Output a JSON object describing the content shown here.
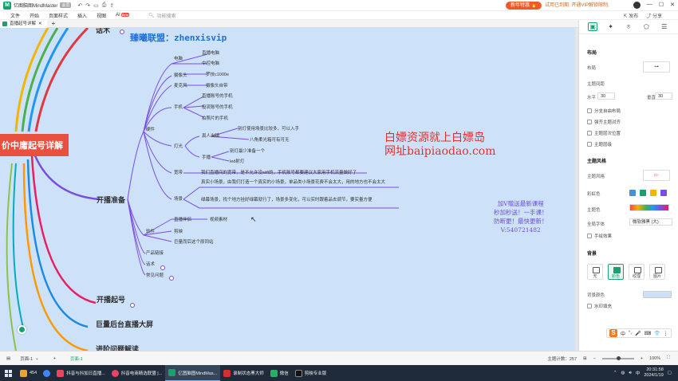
{
  "app": {
    "title": "亿图脑图MindMaster",
    "edition_badge": "会员",
    "promo_pill": "新年特惠 🔥",
    "vip_text": "试用已到期, 开通VIP解锁限制,",
    "publish": "发布",
    "share": "分享",
    "avatar_initials": "张"
  },
  "menu": {
    "items": [
      "文件",
      "开始",
      "页面样式",
      "插入",
      "视图",
      "AI"
    ],
    "ai_badge": "Beta",
    "search_placeholder": "功能搜索"
  },
  "tab": {
    "doc_name": "直播起号详解"
  },
  "canvas": {
    "central": "价中庸起号详解",
    "topics": {
      "top_cut": "话术",
      "prep": "开播准备",
      "start": "开播起号",
      "screen": "巨量后台直播大屏",
      "advanced": "进阶问题解读"
    },
    "watermarks": {
      "w1": "臻曦联盟：zhenxisvip",
      "w2_line1": "白嫖资源就上白嫖岛",
      "w2_line2": "网址baipiaodao.com",
      "w3_line1": "加V赠送最新课程",
      "w3_line2": "秒加秒送！一手课！",
      "w3_line3": "防断更！最快更新！",
      "w3_line4": "V:540721482"
    },
    "nodes": {
      "hardware": "硬件",
      "computer": "电脑",
      "live_pc": "直播电脑",
      "mid_pc": "中控电脑",
      "camera": "摄像头",
      "logitech": "罗技c1000e",
      "mic": "麦克风",
      "cam_self": "摄像头自带",
      "phone": "手机",
      "phone_live": "直播账号的手机",
      "phone_ctrl": "投流账号的手机",
      "phone_photo": "拍照片的手机",
      "light": "灯光",
      "real_out": "真人出镜",
      "buy_light": "别灯使用场景比较多，可以入手",
      "octagon": "八角柔光箱可有可无",
      "handheld": "手播",
      "sole_light": "别灯最少准备一个",
      "led": "led射灯",
      "broadband": "宽带",
      "broadband_text": "我们直播间的宽带，是不允许没wifi的，手机账号都要建议大家用手机流量做好了",
      "scene": "场景",
      "scene_text1": "真实小场景，由我们打造一个真实的小场景，单品类小场景花费不会太大，用的地方也不会太大",
      "scene_text2": "绿幕场景，找个地方挂好绿幕就行了，场景多变化，可以实时跟着品去调节，要实量方便",
      "software": "软件",
      "live_partner": "直播伴侣",
      "video_material": "视频素材",
      "clip": "剪映",
      "other_soft": "巨量而后这个原同站",
      "product_link": "产品链接",
      "script": "话术",
      "common_q": "常见问题"
    }
  },
  "sidebar": {
    "layout_section": "布局",
    "layout_label": "布局",
    "spacing_label": "主题间距",
    "horizontal_label": "水平",
    "horizontal_value": "30",
    "vertical_label": "垂直",
    "vertical_value": "30",
    "checks": [
      "分支自由布局",
      "强齐主题对齐",
      "主题层次位置",
      "主题层级"
    ],
    "style_section": "主题风格",
    "theme_style_label": "主题风格",
    "color_label": "彩虹色",
    "theme_color_label": "主题色",
    "font_label": "全局字体",
    "font_value": "微软雅黑 (大)",
    "hand_drawn": "手绘效果",
    "bg_section": "背景",
    "bg_options": [
      "无",
      "颜色",
      "纹理",
      "图片"
    ],
    "bg_color_label": "背景颜色",
    "watermark": "水印填充",
    "accent": "#1aa06d",
    "bg_color": "#cde2f9"
  },
  "ime": {
    "logo": "S",
    "items": [
      "中",
      "°,",
      "🎤",
      "⌨",
      "👕",
      "⋮"
    ]
  },
  "status": {
    "page_label": "页面-1",
    "active_page": "页面-1",
    "word_count_label": "主题计数：",
    "word_count_value": "257",
    "zoom": "100%"
  },
  "taskbar": {
    "items": [
      {
        "label": "454",
        "color": "#e8a33a"
      },
      {
        "label": "",
        "color": "#4285f4"
      },
      {
        "label": "抖音与抖加日直播...",
        "color": "#e94560"
      },
      {
        "label": "抖音电商精选联盟 |...",
        "color": "#e94560"
      },
      {
        "label": "亿图脑图MindMas...",
        "color": "#1aa06d"
      },
      {
        "label": "录制状态黑大师",
        "color": "#d03030"
      },
      {
        "label": "微信",
        "color": "#2aae67"
      },
      {
        "label": "剪映专业版",
        "color": "#111111"
      }
    ],
    "time": "20:31:58",
    "date": "2024/1/19",
    "ime_tray": "中"
  }
}
